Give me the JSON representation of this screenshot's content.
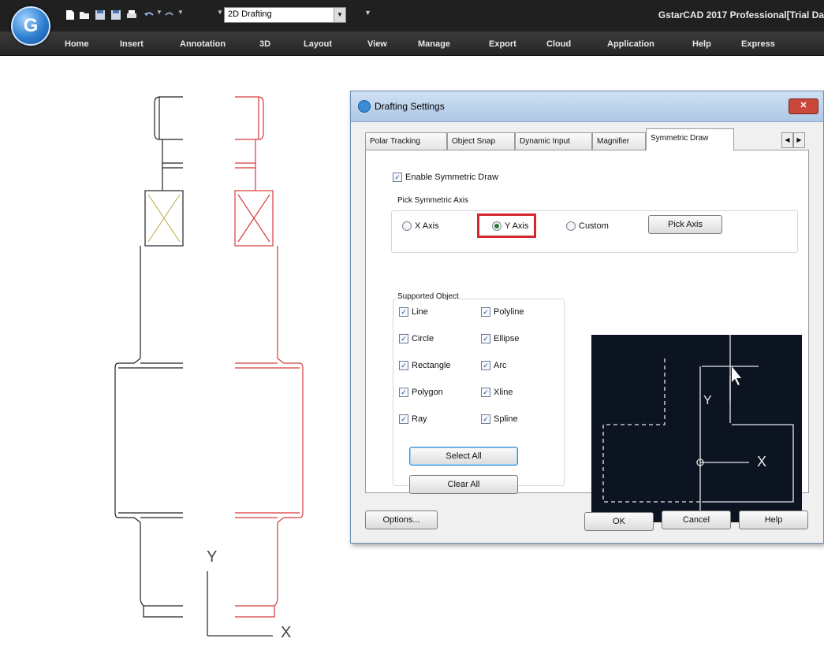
{
  "toolbar": {
    "workspace_value": "2D Drafting",
    "title": "GstarCAD 2017 Professional[Trial Da"
  },
  "menu": [
    "Home",
    "Insert",
    "Annotation",
    "3D",
    "Layout",
    "View",
    "Manage",
    "Export",
    "Cloud",
    "Application",
    "Help",
    "Express"
  ],
  "drawing": {
    "axis_y": "Y",
    "axis_x": "X"
  },
  "dialog": {
    "title": "Drafting Settings",
    "tabs": [
      "Polar Tracking",
      "Object Snap",
      "Dynamic Input",
      "Magnifier",
      "Symmetric Draw"
    ],
    "active_tab": "Symmetric Draw",
    "enable_label": "Enable Symmetric Draw",
    "enable_checked": true,
    "axis_group_title": "Pick Symmetric Axis",
    "axis_options": [
      "X Axis",
      "Y Axis",
      "Custom"
    ],
    "axis_selected": "Y Axis",
    "pick_axis_button": "Pick Axis",
    "supported_title": "Supported Object",
    "objects_left": [
      "Line",
      "Circle",
      "Rectangle",
      "Polygon",
      "Ray"
    ],
    "objects_right": [
      "Polyline",
      "Ellipse",
      "Arc",
      "Xline",
      "Spline"
    ],
    "select_all": "Select All",
    "clear_all": "Clear All",
    "preview_axis_y": "Y",
    "preview_axis_x": "X",
    "buttons": {
      "options": "Options...",
      "ok": "OK",
      "cancel": "Cancel",
      "help": "Help"
    }
  }
}
